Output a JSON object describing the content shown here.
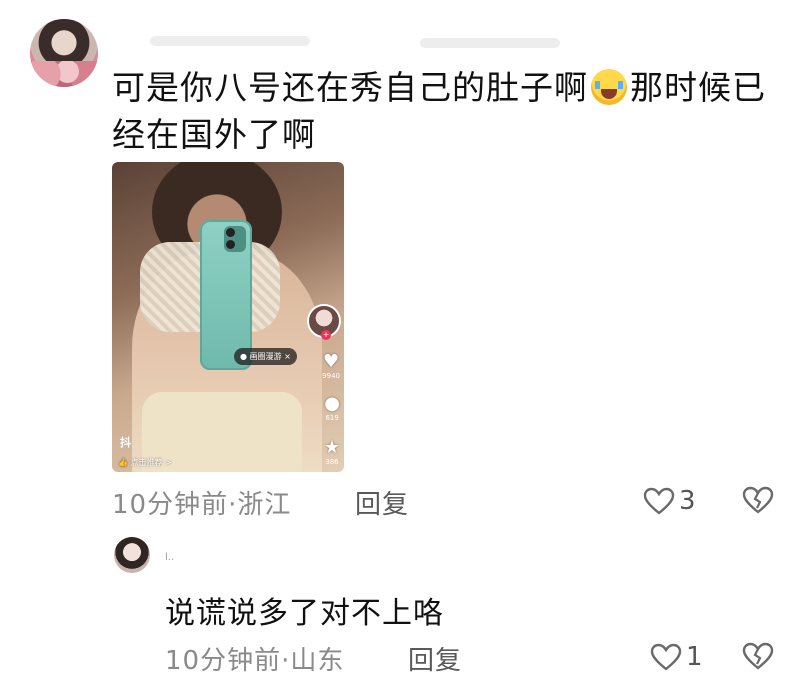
{
  "comments": [
    {
      "text_part1": "可是你八号还在秀自己的肚子啊",
      "emoji": "loudly-crying-face-emoji",
      "text_part2": "那时候已经在国外了啊",
      "time": "10分钟前",
      "location": "·浙江",
      "reply_label": "回复",
      "like_count": "3",
      "image_overlay": {
        "chip_text": "画圈漫游",
        "likes": "9940",
        "comments": "619",
        "favorites": "386",
        "recommend_text": "点击推荐 >",
        "watermark": "抖"
      }
    },
    {
      "author_initial": "l..",
      "text": "说谎说多了对不上咯",
      "time": "10分钟前",
      "location": "·山东",
      "reply_label": "回复",
      "like_count": "1"
    }
  ]
}
